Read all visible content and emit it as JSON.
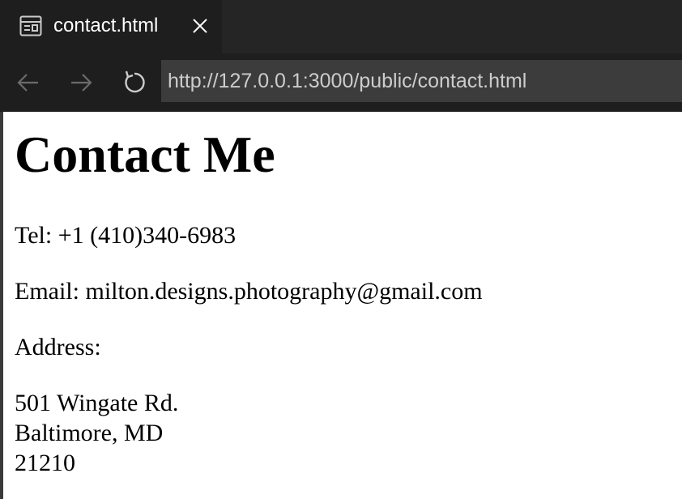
{
  "tab": {
    "title": "contact.html",
    "icon": "preview-icon",
    "close_icon": "close-icon"
  },
  "navigation": {
    "back_icon": "arrow-left-icon",
    "forward_icon": "arrow-right-icon",
    "reload_icon": "reload-icon",
    "url": "http://127.0.0.1:3000/public/contact.html"
  },
  "page": {
    "title": "Contact Me",
    "tel": "Tel: +1 (410)340-6983",
    "email": "Email: milton.designs.photography@gmail.com",
    "address_label": "Address:",
    "address_lines": [
      "501 Wingate Rd.",
      "Baltimore, MD",
      "21210"
    ]
  },
  "colors": {
    "tab_strip": "#252526",
    "toolbar": "#1e1e1e",
    "address_bar": "#3c3c3c",
    "page_background": "#ffffff"
  }
}
